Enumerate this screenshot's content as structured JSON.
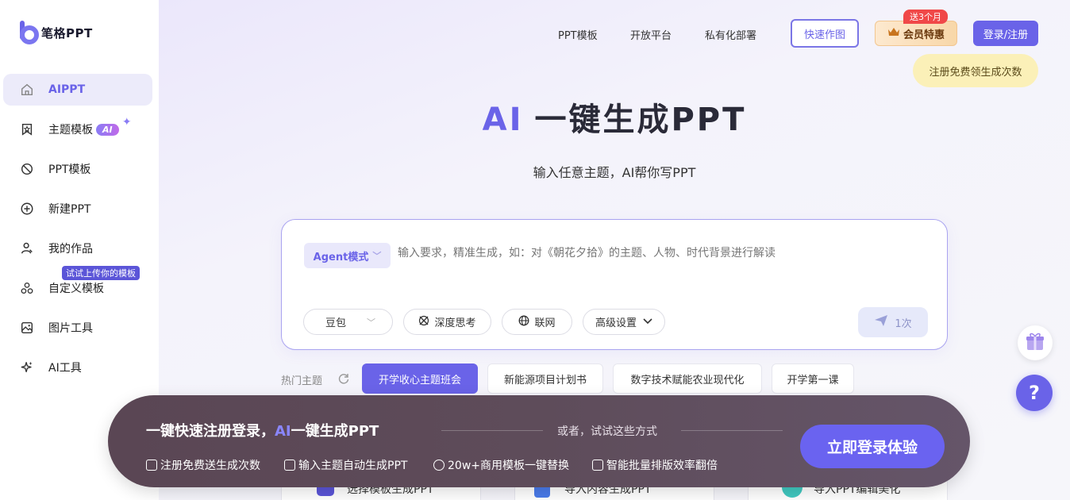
{
  "brand": {
    "name": "笔格PPT"
  },
  "sidebar": {
    "items": [
      {
        "label": "AIPPT",
        "icon": "home-icon"
      },
      {
        "label": "主题模板",
        "icon": "theme-template-icon",
        "badge": "AI"
      },
      {
        "label": "PPT模板",
        "icon": "ppt-template-icon"
      },
      {
        "label": "新建PPT",
        "icon": "plus-circle-icon"
      },
      {
        "label": "我的作品",
        "icon": "user-works-icon"
      },
      {
        "label": "自定义模板",
        "icon": "custom-template-icon",
        "tag": "试试上传你的模板"
      },
      {
        "label": "图片工具",
        "icon": "image-tool-icon"
      },
      {
        "label": "AI工具",
        "icon": "sparkle-icon"
      }
    ]
  },
  "header": {
    "nav": [
      "PPT模板",
      "开放平台",
      "私有化部署"
    ],
    "quick_chart": "快速作图",
    "vip": "会员特惠",
    "vip_badge": "送3个月",
    "login": "登录/注册",
    "tooltip": "注册免费领生成次数"
  },
  "hero": {
    "title_ai": "AI",
    "title_rest": "一键生成PPT",
    "subtitle": "输入任意主题，AI帮你写PPT"
  },
  "input_card": {
    "mode": "Agent模式",
    "placeholder": "输入要求，精准生成，如：对《朝花夕拾》的主题、人物、时代背景进行解读",
    "model": "豆包",
    "deep_think": "深度思考",
    "web": "联网",
    "advanced": "高级设置",
    "send_count": "1次"
  },
  "hot_topics": {
    "label": "热门主题",
    "items": [
      "开学收心主题班会",
      "新能源项目计划书",
      "数字技术赋能农业现代化",
      "开学第一课"
    ]
  },
  "bottom_cards": [
    "选择模板生成PPT",
    "导入内容生成PPT",
    "导入PPT编辑美化"
  ],
  "banner": {
    "title_a": "一键快速注册登录，",
    "title_ai": "AI",
    "title_b": "一键生成PPT",
    "or_text": "或者，试试这些方式",
    "features": [
      "注册免费送生成次数",
      "输入主题自动生成PPT",
      "20w+商用模板一键替换",
      "智能批量排版效率翻倍"
    ],
    "cta": "立即登录体验"
  },
  "float": {
    "help": "?"
  },
  "colors": {
    "accent": "#6a63e8",
    "banner_bg": "#5e4c5a",
    "vip_red": "#f04848"
  }
}
